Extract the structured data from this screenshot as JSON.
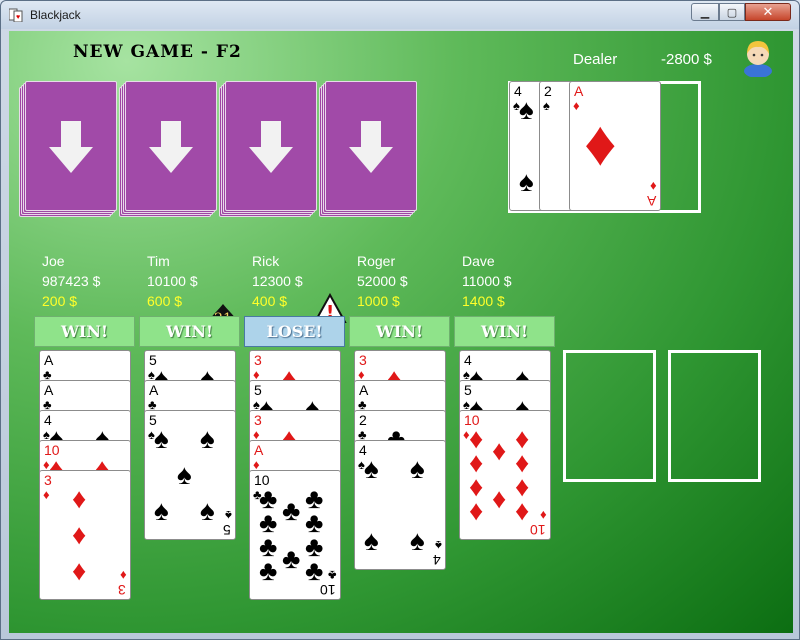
{
  "window": {
    "title": "Blackjack",
    "close_glyph": "✕",
    "min_glyph": "▁",
    "max_glyph": "▢"
  },
  "menu": {
    "new_game": "NEW GAME - F2"
  },
  "dealer": {
    "label": "Dealer",
    "money": "-2800 $",
    "cards": [
      {
        "rank": "4",
        "suit": "♠",
        "color": "black"
      },
      {
        "rank": "2",
        "suit": "♠",
        "color": "black"
      },
      {
        "rank": "A",
        "suit": "♦",
        "color": "red"
      }
    ]
  },
  "players": [
    {
      "name": "Joe",
      "money": "987423 $",
      "bet": "200 $",
      "result": "WIN!",
      "cards": [
        {
          "rank": "A",
          "suit": "♣"
        },
        {
          "rank": "A",
          "suit": "♣"
        },
        {
          "rank": "4",
          "suit": "♠"
        },
        {
          "rank": "10",
          "suit": "♦"
        },
        {
          "rank": "3",
          "suit": "♦"
        }
      ]
    },
    {
      "name": "Tim",
      "money": "10100 $",
      "bet": "600 $",
      "result": "WIN!",
      "badge": "21",
      "cards": [
        {
          "rank": "5",
          "suit": "♠"
        },
        {
          "rank": "A",
          "suit": "♣"
        },
        {
          "rank": "5",
          "suit": "♠"
        }
      ]
    },
    {
      "name": "Rick",
      "money": "12300 $",
      "bet": "400 $",
      "result": "LOSE!",
      "badge_icon": "!",
      "cards": [
        {
          "rank": "3",
          "suit": "♦"
        },
        {
          "rank": "5",
          "suit": "♠"
        },
        {
          "rank": "3",
          "suit": "♦"
        },
        {
          "rank": "A",
          "suit": "♦"
        },
        {
          "rank": "10",
          "suit": "♣"
        }
      ]
    },
    {
      "name": "Roger",
      "money": "52000 $",
      "bet": "1000 $",
      "result": "WIN!",
      "cards": [
        {
          "rank": "3",
          "suit": "♦"
        },
        {
          "rank": "A",
          "suit": "♣"
        },
        {
          "rank": "2",
          "suit": "♣"
        },
        {
          "rank": "4",
          "suit": "♠"
        }
      ]
    },
    {
      "name": "Dave",
      "money": "11000 $",
      "bet": "1400 $",
      "result": "WIN!",
      "cards": [
        {
          "rank": "4",
          "suit": "♠"
        },
        {
          "rank": "5",
          "suit": "♠"
        },
        {
          "rank": "10",
          "suit": "♦"
        }
      ]
    }
  ],
  "colors": {
    "table_green": "#2f9632",
    "deck_purple": "#9d47a3",
    "bet_yellow": "#ffff2a",
    "win_green": "#8fe38a",
    "lose_blue": "#add3ea"
  },
  "icons": {
    "deck": "arrow-down-icon",
    "dealer": "avatar-icon",
    "badge": "spade-21-icon",
    "warning": "warning-icon"
  }
}
